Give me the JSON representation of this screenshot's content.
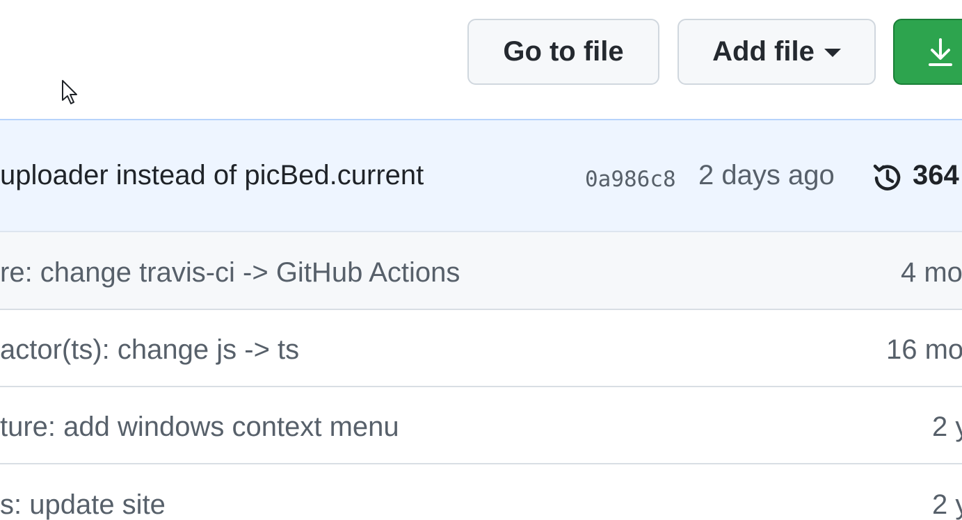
{
  "toolbar": {
    "go_to_file_label": "Go to file",
    "add_file_label": "Add file"
  },
  "latest_commit": {
    "message": "uploader instead of picBed.current",
    "sha": "0a986c8",
    "age": "2 days ago",
    "count": "364"
  },
  "rows": [
    {
      "message": "re: change travis-ci -> GitHub Actions",
      "age": "4 mo"
    },
    {
      "message": "actor(ts): change js -> ts",
      "age": "16 mo"
    },
    {
      "message": "ture: add windows context menu",
      "age": "2 y"
    },
    {
      "message": "s: update site",
      "age": "2 y"
    }
  ],
  "colors": {
    "accent_green": "#2da44e",
    "commit_box_bg": "#eef5ff",
    "muted_text": "#57606a"
  },
  "icons": {
    "code_button_icon": "download-icon",
    "history": "history-icon",
    "caret": "caret-down-icon",
    "cursor": "mouse-cursor-icon"
  }
}
